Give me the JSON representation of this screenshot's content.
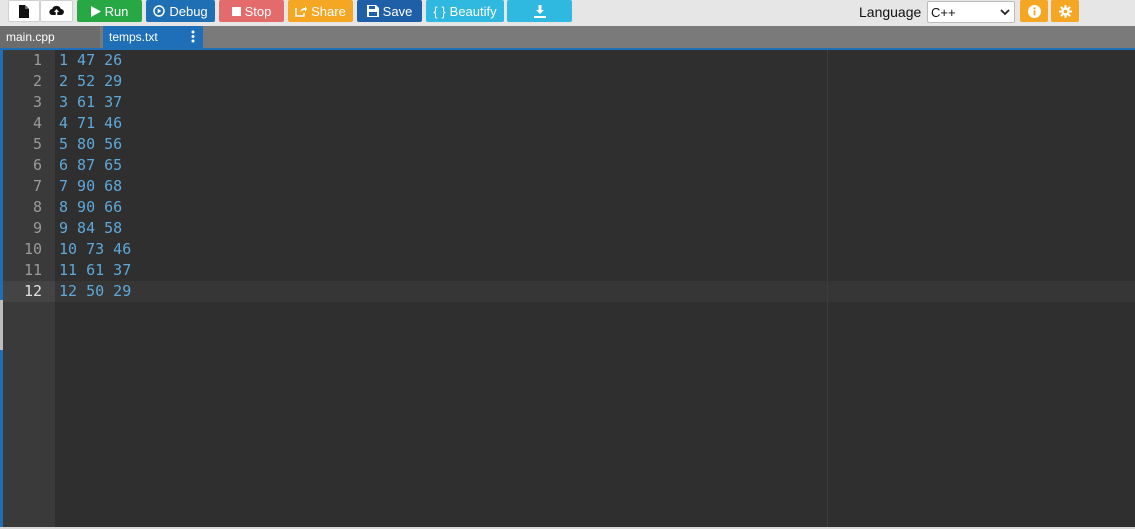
{
  "toolbar": {
    "run_label": "Run",
    "debug_label": "Debug",
    "stop_label": "Stop",
    "share_label": "Share",
    "save_label": "Save",
    "beautify_label": "Beautify",
    "beautify_glyph": "{ }",
    "language_label": "Language",
    "language_value": "C++"
  },
  "tabs": [
    {
      "label": "main.cpp",
      "active": false
    },
    {
      "label": "temps.txt",
      "active": true
    }
  ],
  "editor": {
    "active_line": 12,
    "lines": [
      {
        "num": "1",
        "text": "1 47 26"
      },
      {
        "num": "2",
        "text": "2 52 29"
      },
      {
        "num": "3",
        "text": "3 61 37"
      },
      {
        "num": "4",
        "text": "4 71 46"
      },
      {
        "num": "5",
        "text": "5 80 56"
      },
      {
        "num": "6",
        "text": "6 87 65"
      },
      {
        "num": "7",
        "text": "7 90 68"
      },
      {
        "num": "8",
        "text": "8 90 66"
      },
      {
        "num": "9",
        "text": "9 84 58"
      },
      {
        "num": "10",
        "text": "10 73 46"
      },
      {
        "num": "11",
        "text": "11 61 37"
      },
      {
        "num": "12",
        "text": "12 50 29"
      }
    ]
  },
  "colors": {
    "run": "#28a745",
    "debug": "#1f6fb5",
    "stop": "#e36b6b",
    "share": "#f5a623",
    "save": "#1f5fa8",
    "beautify": "#2fb8e0",
    "active_tab": "#1e6fb8",
    "code_text": "#5fa8d8"
  }
}
